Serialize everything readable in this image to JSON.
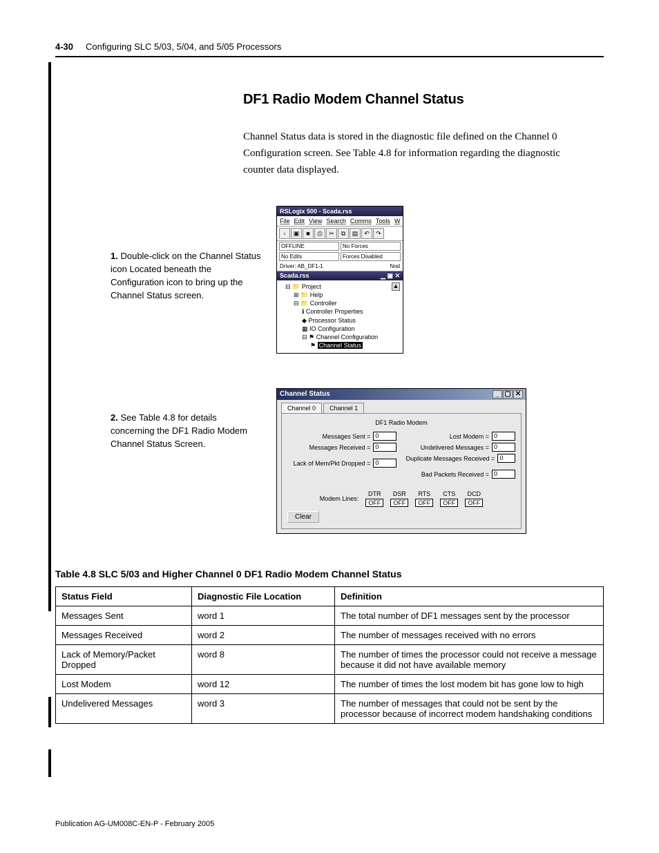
{
  "header": {
    "page_number": "4-30",
    "chapter": "Configuring SLC 5/03, 5/04, and 5/05 Processors"
  },
  "section": {
    "heading": "DF1 Radio Modem Channel Status",
    "paragraph": "Channel Status data is stored in the diagnostic file defined on the Channel 0 Configuration screen. See Table 4.8 for information regarding the diagnostic counter data displayed."
  },
  "steps": {
    "s1": {
      "num": "1.",
      "text": "Double-click on the Channel Status icon Located beneath the Configuration icon to bring up the Channel Status screen."
    },
    "s2": {
      "num": "2.",
      "text": "See Table 4.8 for details concerning the DF1 Radio Modem Channel Status Screen."
    }
  },
  "fig1": {
    "title": "RSLogix 500 - Scada.rss",
    "menu": {
      "file": "File",
      "edit": "Edit",
      "view": "View",
      "search": "Search",
      "comms": "Comms",
      "tools": "Tools",
      "w": "W"
    },
    "status": {
      "offline": "OFFLINE",
      "noforces": "No Forces",
      "noedits": "No Edits",
      "forces_disabled": "Forces Disabled"
    },
    "driver_label": "Driver: AB_DF1-1",
    "driver_right": "Nod",
    "sub_title": "Scada.rss",
    "tree": {
      "project": "Project",
      "help": "Help",
      "controller": "Controller",
      "cp": "Controller Properties",
      "ps": "Processor Status",
      "io": "IO Configuration",
      "cc": "Channel Configuration",
      "cs": "Channel Status"
    }
  },
  "fig2": {
    "title": "Channel Status",
    "tab0": "Channel 0",
    "tab1": "Channel 1",
    "panel_title": "DF1 Radio Modem",
    "left": {
      "msg_sent": "Messages Sent =",
      "msg_recv": "Messages Received =",
      "lack": "Lack of Mem/Pkt Dropped ="
    },
    "right": {
      "lost": "Lost Modem =",
      "undeliv": "Undelivered Messages =",
      "dup": "Duplicate Messages Received =",
      "bad": "Bad Packets Received ="
    },
    "zero": "0",
    "modem_label": "Modem Lines:",
    "lines": {
      "dtr": "DTR",
      "dsr": "DSR",
      "rts": "RTS",
      "cts": "CTS",
      "dcd": "DCD"
    },
    "off": "OFF",
    "clear": "Clear"
  },
  "table": {
    "caption": "Table 4.8 SLC 5/03 and Higher Channel 0 DF1 Radio Modem Channel Status",
    "headers": {
      "c1": "Status Field",
      "c2": "Diagnostic File Location",
      "c3": "Definition"
    },
    "rows": [
      {
        "c1": "Messages Sent",
        "c2": "word 1",
        "c3": "The total number of DF1 messages sent by the processor"
      },
      {
        "c1": "Messages Received",
        "c2": "word 2",
        "c3": "The number of messages received with no errors"
      },
      {
        "c1": "Lack of Memory/Packet Dropped",
        "c2": "word 8",
        "c3": "The number of times the processor could not receive a message because it did not have available memory"
      },
      {
        "c1": "Lost Modem",
        "c2": "word 12",
        "c3": "The number of times the lost modem bit has gone low to high"
      },
      {
        "c1": "Undelivered Messages",
        "c2": "word 3",
        "c3": "The number of messages that could not be sent by the processor because of incorrect modem handshaking conditions"
      }
    ]
  },
  "footer": "Publication AG-UM008C-EN-P - February 2005"
}
